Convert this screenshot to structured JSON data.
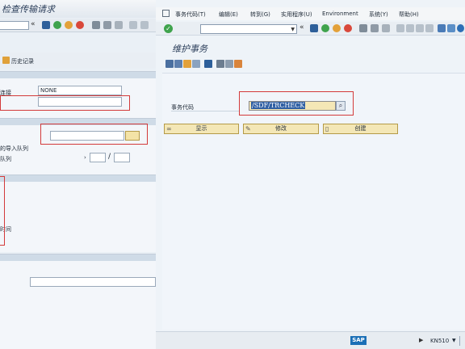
{
  "background_window": {
    "title": "检查传输请求",
    "history_label": "历史记录",
    "field_value_none": "NONE",
    "label_connection": "连接",
    "label_import_queue": "的导入队列",
    "label_queue": "队列",
    "label_time": "时间",
    "separator_slash": "/"
  },
  "foreground_window": {
    "menu": [
      "事务代码(T)",
      "编辑(E)",
      "转到(G)",
      "实用程序(U)",
      "Environment",
      "系统(Y)",
      "帮助(H)"
    ],
    "title": "维护事务",
    "tcode_label": "事务代码",
    "tcode_value": "/SDF/TRCHECK",
    "buttons": {
      "display": "显示",
      "change": "修改",
      "create": "创建"
    },
    "status": {
      "sap_logo": "SAP",
      "system": "KN510"
    }
  },
  "colors": {
    "highlight_red": "#d33a3a",
    "button_yellow": "#f4e7b6",
    "selection_blue": "#2f5fa3"
  }
}
